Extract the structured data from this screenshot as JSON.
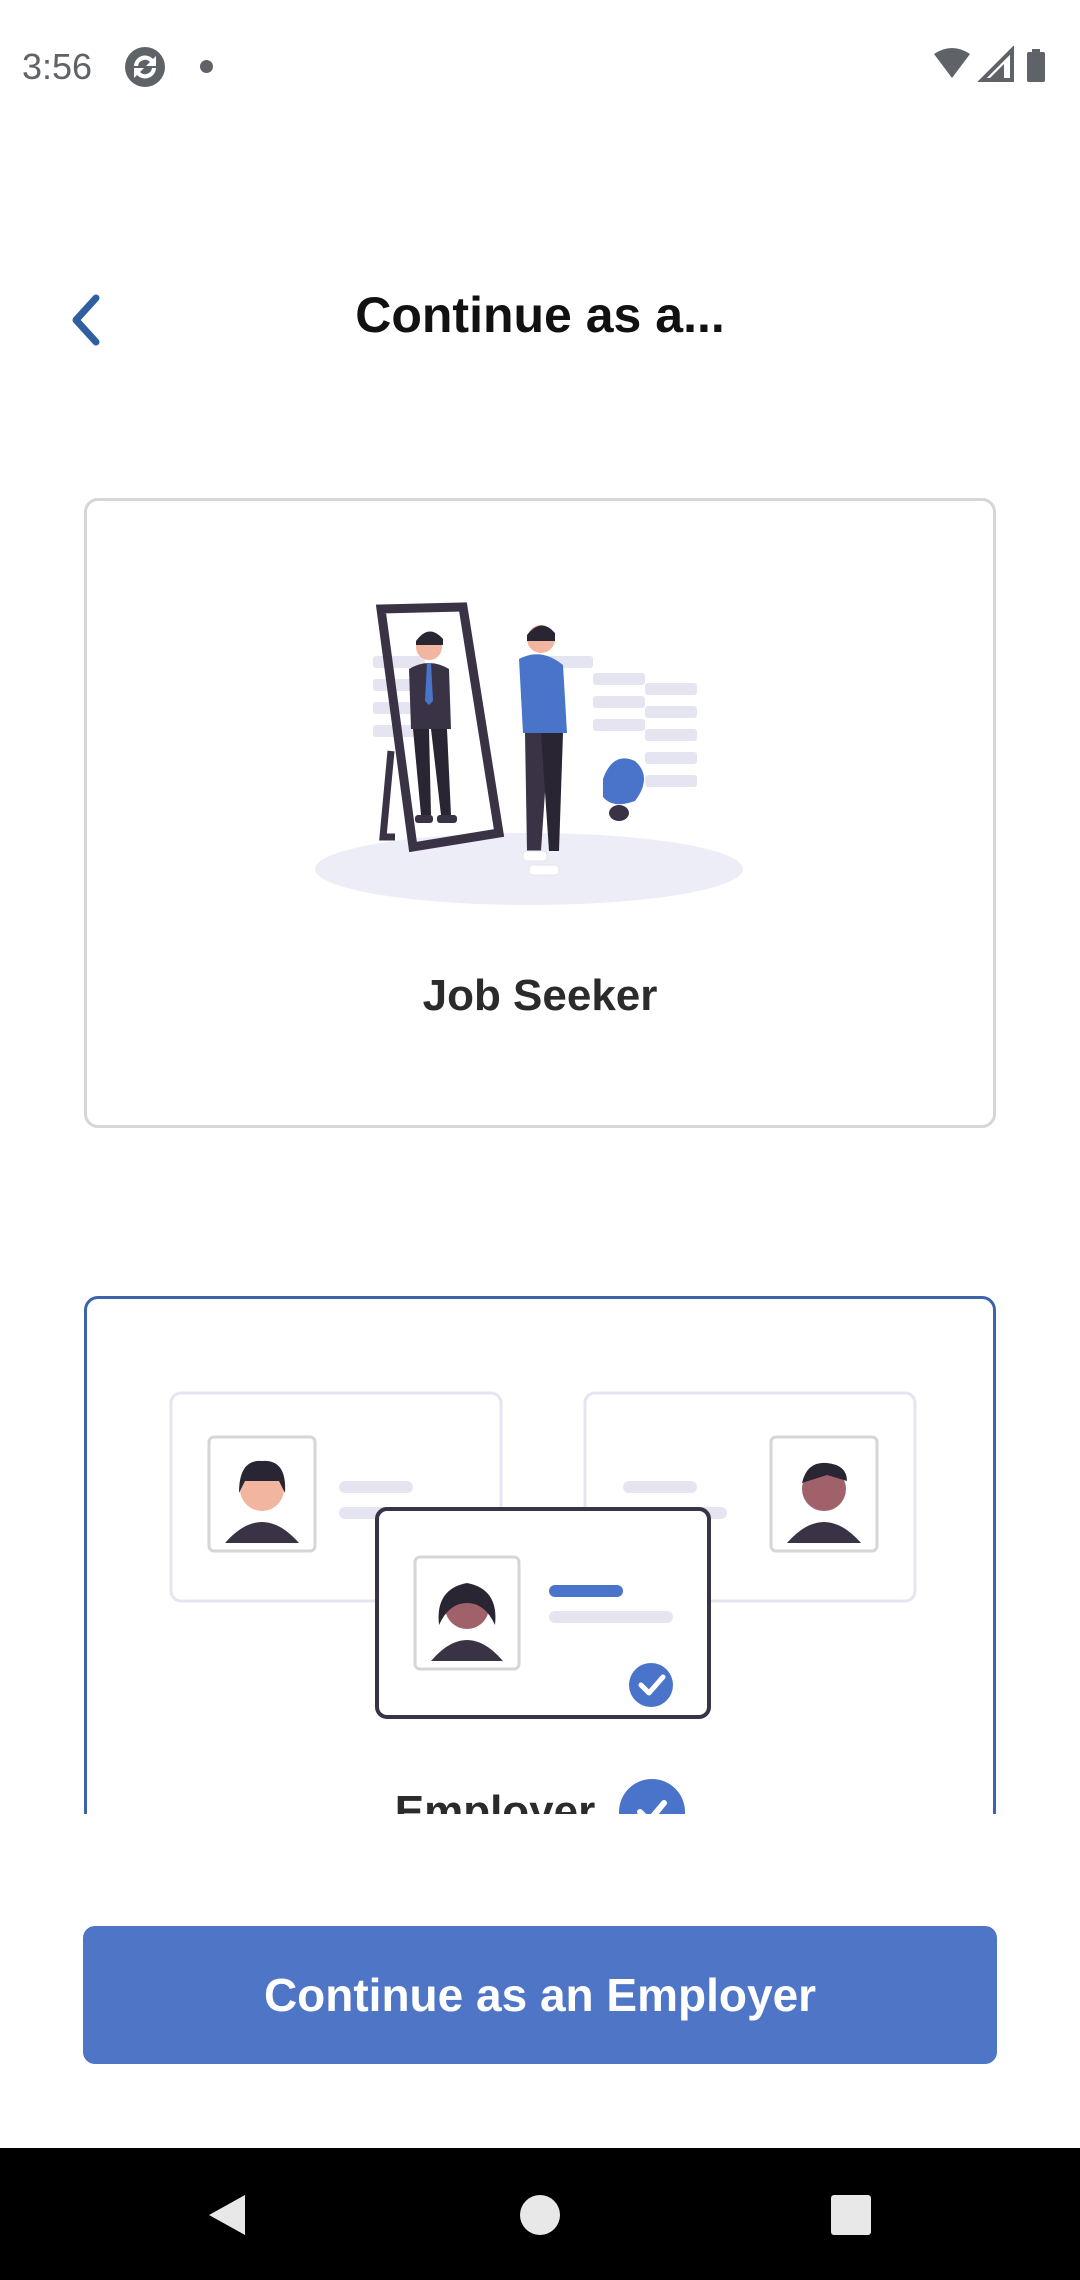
{
  "status_bar": {
    "time": "3:56",
    "icons": [
      "app-sync-icon",
      "notification-dot-icon",
      "wifi-icon",
      "cell-signal-icon",
      "battery-icon"
    ]
  },
  "header": {
    "back_icon": "chevron-left-icon",
    "title": "Continue as a..."
  },
  "options": [
    {
      "label": "Job Seeker",
      "selected": false,
      "illustration": "person-mirror-illustration"
    },
    {
      "label": "Employer",
      "selected": true,
      "illustration": "candidate-profiles-illustration"
    }
  ],
  "primary_action": {
    "label": "Continue as an Employer"
  },
  "nav_bar": {
    "icons": [
      "back-triangle-icon",
      "home-circle-icon",
      "recents-square-icon"
    ]
  },
  "colors": {
    "accent": "#4f75c6",
    "back_chevron": "#2f5f9f",
    "selected_border": "#3e63ad",
    "card_border": "#d6d6d9",
    "check_badge": "#4a74c9"
  }
}
